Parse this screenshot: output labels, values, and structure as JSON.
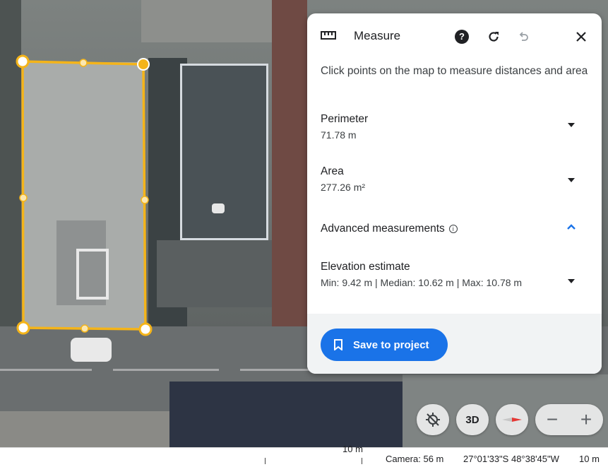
{
  "panel": {
    "title": "Measure",
    "hint": "Click points on the map to measure distances and area",
    "perimeter_label": "Perimeter",
    "perimeter_value": "71.78 m",
    "area_label": "Area",
    "area_value": "277.26 m²",
    "advanced_label": "Advanced measurements",
    "elevation_label": "Elevation estimate",
    "elevation_value": "Min: 9.42 m | Median: 10.62 m | Max: 10.78 m",
    "save_label": "Save to project",
    "icons": [
      "ruler-icon",
      "help-icon",
      "refresh-icon",
      "undo-icon",
      "close-icon",
      "chevron-down-icon",
      "chevron-up-icon",
      "info-icon",
      "bookmark-icon"
    ]
  },
  "controls": {
    "view_3d": "3D",
    "zoom_out": "−",
    "zoom_in": "+"
  },
  "status_bar": {
    "scale_left": "10 m",
    "camera": "Camera: 56 m",
    "coordinates": "27°01'33\"S 48°38'45\"W",
    "scale_right": "10 m"
  },
  "colors": {
    "measure_outline": "#f4b41a",
    "accent": "#1a73e8"
  }
}
